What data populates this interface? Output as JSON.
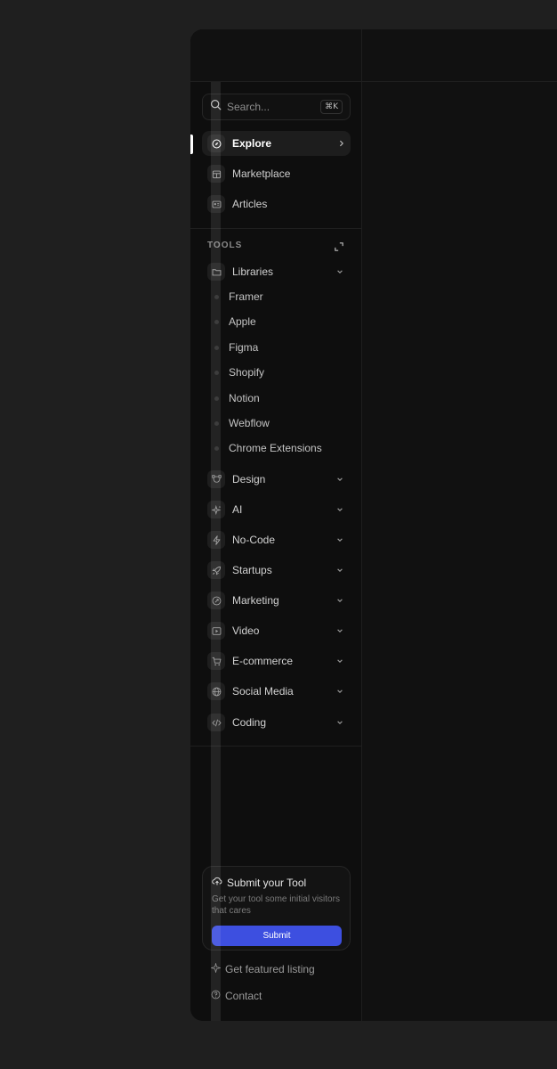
{
  "search": {
    "placeholder": "Search...",
    "shortcut": "⌘K"
  },
  "nav": [
    {
      "label": "Explore",
      "icon": "compass-icon",
      "active": true
    },
    {
      "label": "Marketplace",
      "icon": "store-icon"
    },
    {
      "label": "Articles",
      "icon": "article-icon"
    }
  ],
  "tools": {
    "section_label": "TOOLS",
    "libraries": {
      "label": "Libraries",
      "items": [
        "Framer",
        "Apple",
        "Figma",
        "Shopify",
        "Notion",
        "Webflow",
        "Chrome Extensions"
      ]
    },
    "categories": [
      {
        "label": "Design",
        "icon": "vector-icon"
      },
      {
        "label": "AI",
        "icon": "sparkle-icon"
      },
      {
        "label": "No-Code",
        "icon": "bolt-icon"
      },
      {
        "label": "Startups",
        "icon": "rocket-icon"
      },
      {
        "label": "Marketing",
        "icon": "target-icon"
      },
      {
        "label": "Video",
        "icon": "play-icon"
      },
      {
        "label": "E-commerce",
        "icon": "cart-icon"
      },
      {
        "label": "Social Media",
        "icon": "globe-icon"
      },
      {
        "label": "Coding",
        "icon": "code-icon"
      }
    ]
  },
  "submit": {
    "title": "Submit your Tool",
    "description": "Get your tool some initial visitors that cares",
    "button": "Submit"
  },
  "footer": {
    "featured": "Get featured listing",
    "contact": "Contact"
  },
  "colors": {
    "accent": "#3d4fe0",
    "background": "#0e0e0e",
    "page": "#1f1f1f"
  }
}
